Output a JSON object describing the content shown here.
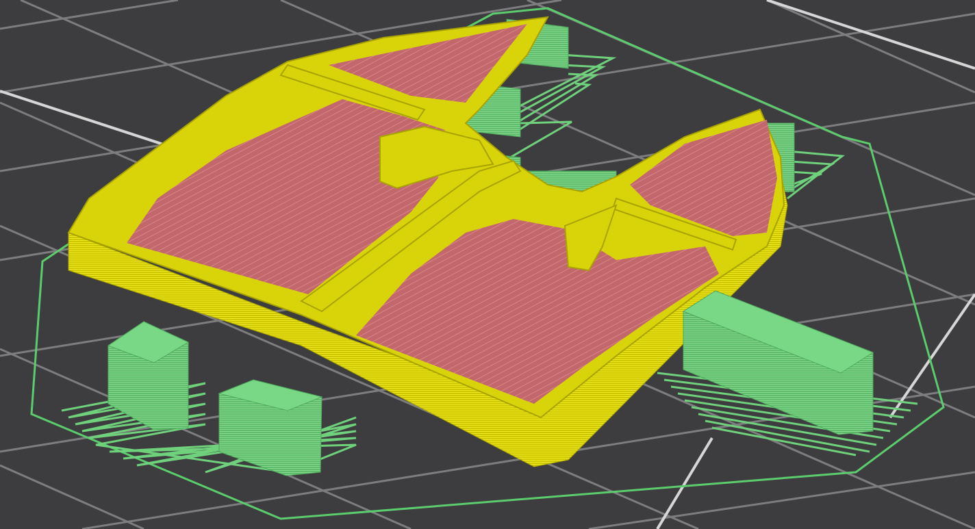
{
  "viewport": {
    "view_mode": "sliced-preview",
    "background_color": "#3d3d3f"
  },
  "colors": {
    "bed_grid": "#8a8a8a",
    "bed_grid_major": "#d4d4d4",
    "skirt": "#59c96b",
    "support": "#6fcb7b",
    "support_dark": "#4fa95c",
    "perimeter": "#d9d40a",
    "perimeter_dark": "#a8a300",
    "infill": "#c26468",
    "infill_line": "#d9888a"
  },
  "objects": [
    {
      "name": "main-part",
      "features": [
        "perimeter",
        "solid-infill"
      ]
    },
    {
      "name": "support-block-left",
      "features": [
        "support"
      ]
    },
    {
      "name": "support-block-left-2",
      "features": [
        "support"
      ]
    },
    {
      "name": "support-block-right",
      "features": [
        "support"
      ]
    },
    {
      "name": "support-block-back",
      "features": [
        "support"
      ]
    }
  ]
}
